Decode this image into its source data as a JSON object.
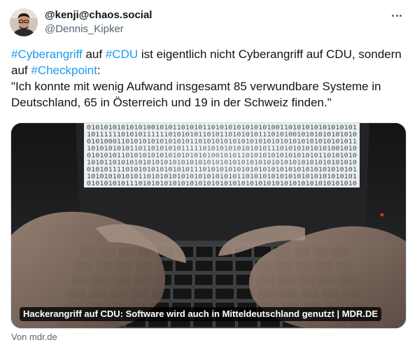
{
  "author": {
    "display_name": "@kenji@chaos.social",
    "handle": "@Dennis_Kipker",
    "avatar_icon": "person-avatar"
  },
  "more_menu": {
    "icon": "more-horizontal-icon"
  },
  "tweet": {
    "hashtag_1": "#Cyberangriff",
    "text_1": " auf ",
    "hashtag_2": "#CDU",
    "text_2": " ist eigentlich nicht Cyberangriff auf CDU, sondern auf ",
    "hashtag_3": "#Checkpoint",
    "text_3": ":\n\"Ich konnte mit wenig Aufwand insgesamt 85 verwundbare Systeme in Deutschland, 65 in Österreich und 19 in der Schweiz finden.\""
  },
  "card": {
    "caption": "Hackerangriff auf CDU: Software wird auch in Mitteldeutschland genutzt | MDR.DE",
    "source": "Von mdr.de",
    "binary_lines": [
      "010101010101010010101101010110101010101010100110101010101010101",
      "101111110101011111101010101101011010101011101010010101010101010",
      "010100011010101010101010110101010101010101010101010101010101011",
      "101010101011011010101011111010101010101010111010101010101001010",
      "010101011010101010101010101010010101101010101010101010110101010",
      "101011010101010101010101010101010101010101010101010101010101010",
      "010101111010101010101010111010101010101010101010101010101010101",
      "101010101010110101010101010101010101101010101010101010101010101",
      "010101010111010101010101010101010101010101010101010101010101010"
    ],
    "colors": {
      "screen": "#eef3f4",
      "laptop_body": "#2a2a2c",
      "key": "#151515"
    }
  }
}
